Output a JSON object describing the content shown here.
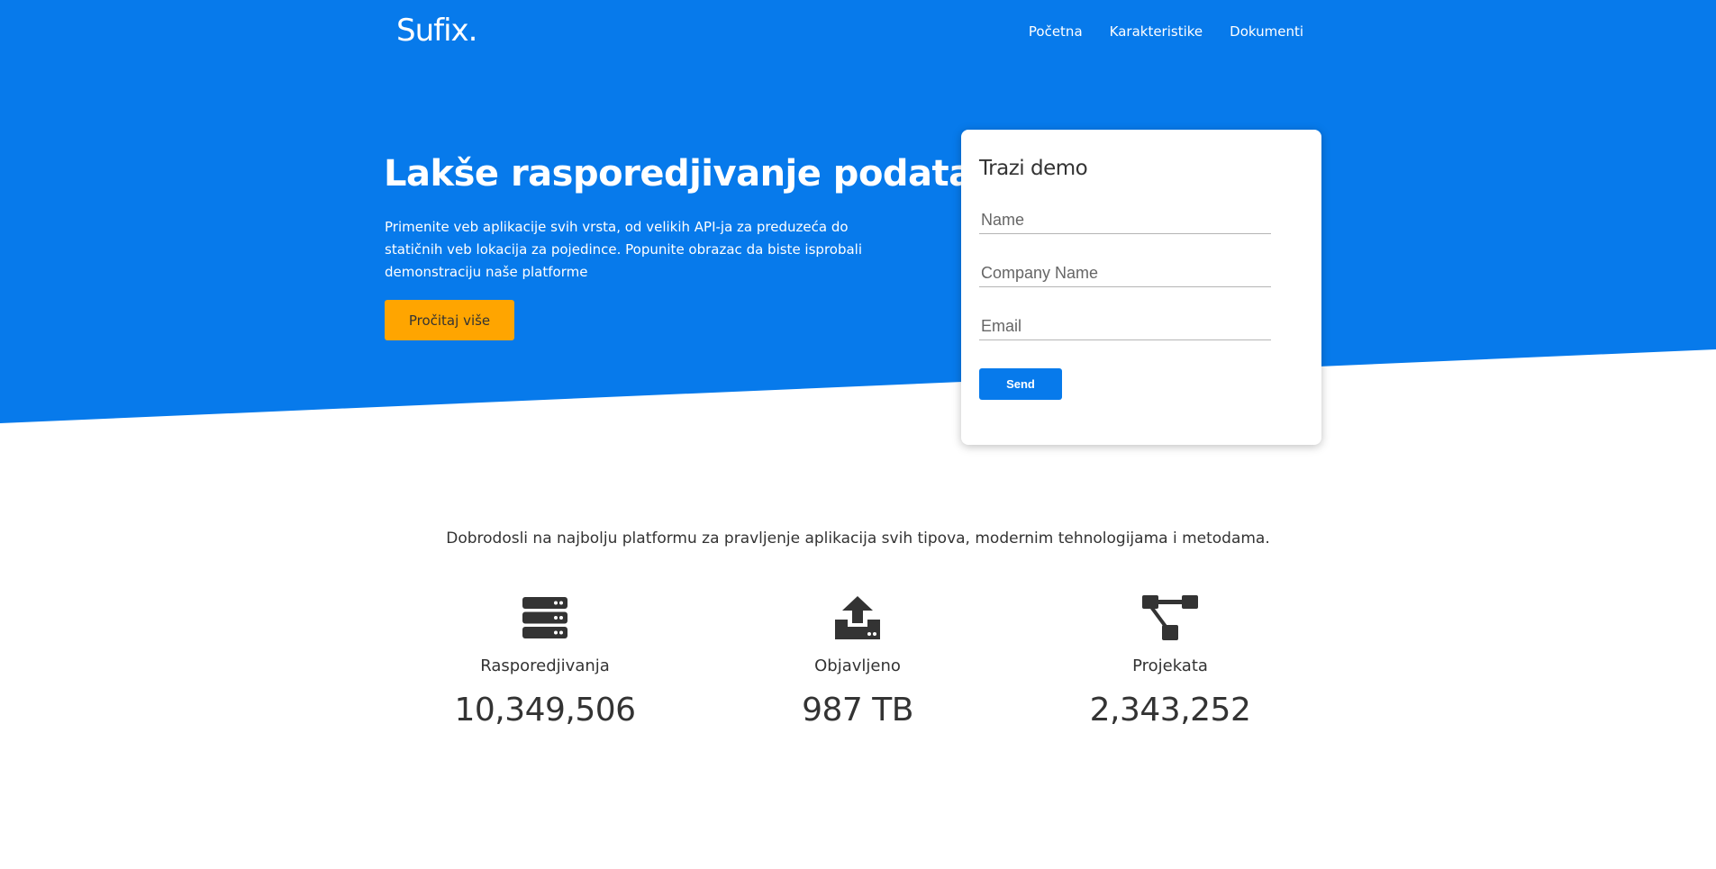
{
  "header": {
    "logo": "Sufix.",
    "nav": [
      "Početna",
      "Karakteristike",
      "Dokumenti"
    ]
  },
  "hero": {
    "title": "Lakše rasporedjivanje podataka",
    "text": "Primenite veb aplikacije svih vrsta, od velikih API-ja za preduzeća do statičnih veb lokacija za pojedince. Popunite obrazac da biste isprobali demonstraciju naše platforme",
    "button_label": "Pročitaj više"
  },
  "demo_form": {
    "title": "Trazi demo",
    "name_placeholder": "Name",
    "company_placeholder": "Company Name",
    "email_placeholder": "Email",
    "send_label": "Send"
  },
  "welcome": {
    "text": "Dobrodosli na najbolju platformu za pravljenje aplikacija svih tipova, modernim tehnologijama i metodama."
  },
  "stats": [
    {
      "icon": "server-icon",
      "label": "Rasporedjivanja",
      "value": "10,349,506"
    },
    {
      "icon": "upload-icon",
      "label": "Objavljeno",
      "value": "987 TB"
    },
    {
      "icon": "project-diagram-icon",
      "label": "Projekata",
      "value": "2,343,252"
    }
  ],
  "colors": {
    "primary": "#077AEB",
    "accent": "#FFA500",
    "text": "#333333"
  }
}
